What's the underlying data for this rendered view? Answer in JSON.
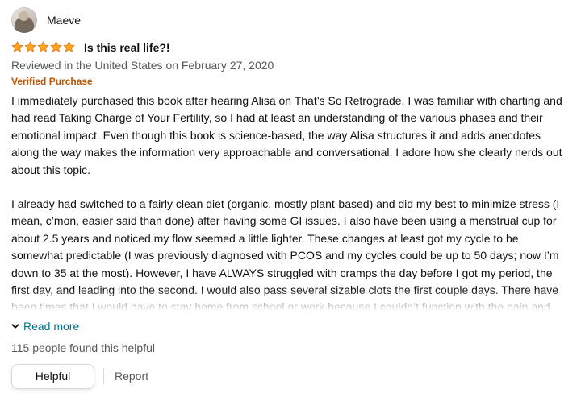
{
  "reviewer": {
    "name": "Maeve"
  },
  "rating": {
    "stars": 5,
    "max_stars": 5,
    "color": "#ffa41c"
  },
  "review": {
    "title": "Is this real life?!",
    "date": "Reviewed in the United States on February 27, 2020",
    "verified_badge": "Verified Purchase",
    "paragraphs": [
      "I immediately purchased this book after hearing Alisa on That’s So Retrograde. I was familiar with charting and had read Taking Charge of Your Fertility, so I had at least an understanding of the various phases and their emotional impact. Even though this book is science-based, the way Alisa structures it and adds anecdotes along the way makes the information very approachable and conversational. I adore how she clearly nerds out about this topic.",
      "I already had switched to a fairly clean diet (organic, mostly plant-based) and did my best to minimize stress (I mean, c’mon, easier said than done) after having some GI issues. I also have been using a menstrual cup for about 2.5 years and noticed my flow seemed a little lighter. These changes at least got my cycle to be somewhat predictable (I was previously diagnosed with PCOS and my cycles could be up to 50 days; now I’m down to 35 at the most). However, I have ALWAYS struggled with cramps the day before I got my period, the first day, and leading into the second. I would also pass several sizable clots the first couple days. There have been times that I would have to stay home from school or work because I couldn’t function with the pain and heavy flow. It never crossed my mind that this isn’t “normal.” I always thought"
    ],
    "read_more": "Read more",
    "helpful_count": "115 people found this helpful",
    "helpful_button": "Helpful",
    "report_link": "Report"
  },
  "colors": {
    "text": "#0f1111",
    "secondary": "#565959",
    "verified": "#c45500",
    "link": "#007185",
    "border": "#d5d9d9"
  },
  "icons": {
    "avatar": "avatar",
    "star": "star-icon",
    "chevron": "chevron-down-icon"
  }
}
